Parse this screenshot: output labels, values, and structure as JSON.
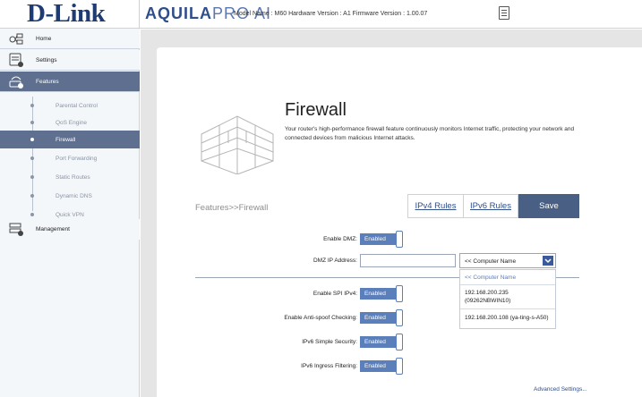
{
  "header": {
    "logo_text": "D-Link",
    "brand_bold": "AQUILA",
    "brand_thin": "PRO AI",
    "model_info": "Model Name : M60  Hardware Version : A1  Firmware Version : 1.00.07",
    "doc_icon": "document-icon"
  },
  "sidebar": {
    "main": [
      {
        "label": "Home",
        "icon": "home-network-icon"
      },
      {
        "label": "Settings",
        "icon": "settings-icon"
      },
      {
        "label": "Features",
        "icon": "features-icon"
      },
      {
        "label": "Management",
        "icon": "management-icon"
      }
    ],
    "sub": [
      {
        "label": "Parental Control"
      },
      {
        "label": "QoS Engine"
      },
      {
        "label": "Firewall"
      },
      {
        "label": "Port Forwarding"
      },
      {
        "label": "Static Routes"
      },
      {
        "label": "Dynamic DNS"
      },
      {
        "label": "Quick VPN"
      }
    ],
    "active_main": "Features",
    "active_sub": "Firewall"
  },
  "main": {
    "title": "Firewall",
    "description": "Your router's high-performance firewall feature continuously monitors Internet traffic, protecting your network and connected devices from malicious Internet attacks.",
    "breadcrumb": "Features>>Firewall",
    "tabs": {
      "ipv4": "IPv4 Rules",
      "ipv6": "IPv6 Rules"
    },
    "save_label": "Save",
    "fields": {
      "enable_dmz": {
        "label": "Enable DMZ:",
        "value": "Enabled"
      },
      "dmz_ip": {
        "label": "DMZ IP Address:",
        "value": ""
      },
      "spi_ipv4": {
        "label": "Enable SPI IPv4:",
        "value": "Enabled"
      },
      "anti_spoof": {
        "label": "Enable Anti-spoof Checking:",
        "value": "Enabled"
      },
      "ipv6_simple": {
        "label": "IPv6 Simple Security:",
        "value": "Enabled"
      },
      "ipv6_ingress": {
        "label": "IPv6 Ingress Filtering:",
        "value": "Enabled"
      }
    },
    "computer_select": {
      "selected": "<< Computer Name",
      "options": [
        "<< Computer Name",
        "192.168.200.235 (09262NBWIN10)",
        "192.168.200.108 (ya-ting-s-A50)"
      ]
    },
    "advanced_link": "Advanced Settings..."
  },
  "colors": {
    "accent": "#5e6f8f",
    "toggle": "#5b7fba",
    "save": "#4a5f84",
    "link": "#2f4e8a"
  }
}
